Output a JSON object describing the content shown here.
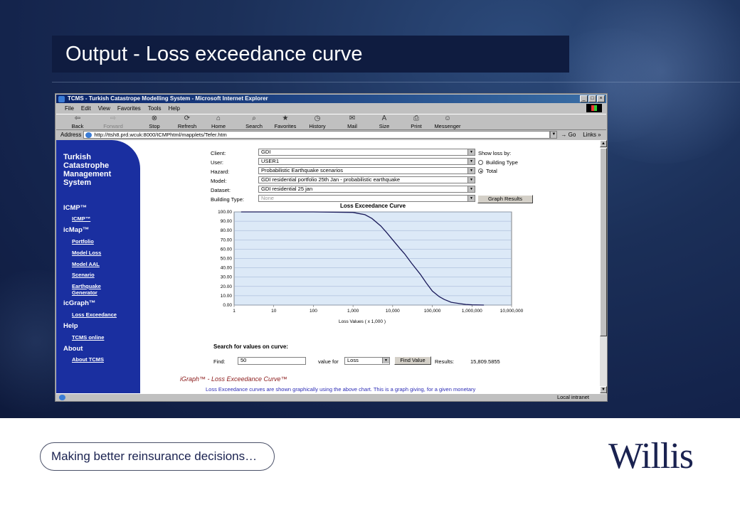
{
  "slide": {
    "title": "Output - Loss exceedance curve",
    "tagline": "Making better reinsurance decisions…",
    "logo": "Willis"
  },
  "browser": {
    "window_title": "TCMS - Turkish Catastrope Modelling System - Microsoft Internet Explorer",
    "menu": [
      "File",
      "Edit",
      "View",
      "Favorites",
      "Tools",
      "Help"
    ],
    "toolbar": [
      {
        "label": "Back",
        "icon": "back-arrow-icon"
      },
      {
        "label": "Forward",
        "icon": "forward-arrow-icon"
      },
      {
        "label": "Stop",
        "icon": "stop-icon"
      },
      {
        "label": "Refresh",
        "icon": "refresh-icon"
      },
      {
        "label": "Home",
        "icon": "home-icon"
      },
      {
        "label": "Search",
        "icon": "search-icon"
      },
      {
        "label": "Favorites",
        "icon": "favorites-icon"
      },
      {
        "label": "History",
        "icon": "history-icon"
      },
      {
        "label": "Mail",
        "icon": "mail-icon"
      },
      {
        "label": "Size",
        "icon": "size-icon"
      },
      {
        "label": "Print",
        "icon": "print-icon"
      },
      {
        "label": "Messenger",
        "icon": "messenger-icon"
      }
    ],
    "address_label": "Address",
    "url": "http://ttsh8.prd.wcuk:8000/ICMPhtml/mapplets/Tefer.htm",
    "go_label": "Go",
    "links_label": "Links",
    "status_zone": "Local intranet"
  },
  "nav": {
    "brand": "Turkish Catastrophe Management System",
    "sections": [
      {
        "title": "ICMP™",
        "links": [
          "ICMP™"
        ]
      },
      {
        "title": "icMap™",
        "links": [
          "Portfolio",
          "Model Loss",
          "Model AAL",
          "Scenario",
          "Earthquake Generator"
        ]
      },
      {
        "title": "icGraph™",
        "links": [
          "Loss Exceedance"
        ]
      },
      {
        "title": "Help",
        "links": [
          "TCMS online"
        ]
      },
      {
        "title": "About",
        "links": [
          "About TCMS"
        ]
      }
    ]
  },
  "form": {
    "client_label": "Client:",
    "client": "GDI",
    "user_label": "User:",
    "user": "USER1",
    "hazard_label": "Hazard:",
    "hazard": "Probabilistic Earthquake scenarios",
    "model_label": "Model:",
    "model": "GDI residential portfolio 25th Jan - probabilistic earthquake",
    "dataset_label": "Dataset:",
    "dataset": "GDI residential 25 jan",
    "building_type_label": "Building Type:",
    "building_type": "None",
    "show_loss_label": "Show loss by:",
    "radio_building_type": "Building Type",
    "radio_total": "Total",
    "graph_button": "Graph Results"
  },
  "search": {
    "title": "Search for values on curve:",
    "find_label": "Find:",
    "find_value": "50",
    "value_for_label": "value for",
    "value_for_option": "Loss",
    "find_button": "Find Value",
    "results_label": "Results:",
    "results_value": "15,809.5855"
  },
  "igraph": {
    "title": "iGraph™ - Loss Exceedance Curve™",
    "body": "Loss Exceedance curves are shown graphically using the above chart. This is a graph giving, for a given monetary"
  },
  "chart_data": {
    "type": "line",
    "title": "Loss Exceedance Curve",
    "xlabel": "Loss Values  ( x 1,000 )",
    "ylabel": "",
    "x_scale": "log",
    "xlim": [
      1,
      10000000
    ],
    "ylim": [
      0,
      100
    ],
    "x_tick_labels": [
      "1",
      "10",
      "100",
      "1,000",
      "10,000",
      "100,000",
      "1,000,000",
      "10,000,000"
    ],
    "y_tick_labels": [
      "100.00",
      "90.00",
      "80.00",
      "70.00",
      "60.00",
      "50.00",
      "40.00",
      "30.00",
      "20.00",
      "10.00",
      "0.00"
    ],
    "grid": true,
    "series": [
      {
        "x": [
          1.5,
          10,
          100,
          1000,
          2000,
          3000,
          5000,
          7000,
          10000,
          15000,
          20000,
          30000,
          50000,
          70000,
          100000,
          150000,
          200000,
          300000,
          500000,
          700000,
          1000000,
          2000000
        ],
        "y": [
          100,
          100,
          100,
          99.5,
          97,
          93,
          85,
          78,
          70,
          61,
          55,
          45,
          33,
          24,
          15,
          9,
          6,
          3,
          1.5,
          0.7,
          0.2,
          0
        ]
      }
    ],
    "colors": {
      "line": "#1a1a5a",
      "plot_bg": "#dce9f7",
      "grid": "#9aaed0"
    }
  }
}
